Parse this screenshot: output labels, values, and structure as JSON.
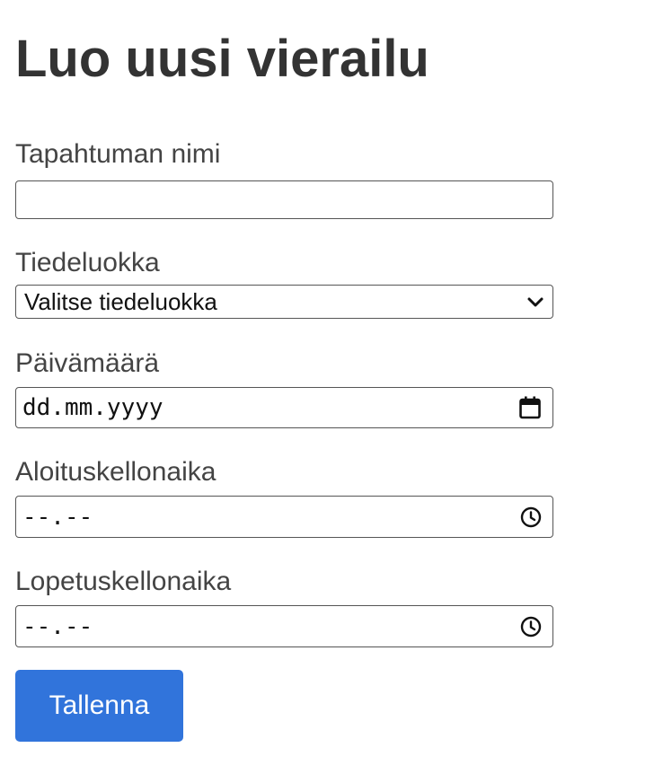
{
  "title": "Luo uusi vierailu",
  "fields": {
    "event_name": {
      "label": "Tapahtuman nimi",
      "value": ""
    },
    "category": {
      "label": "Tiedeluokka",
      "selected": "Valitse tiedeluokka"
    },
    "date": {
      "label": "Päivämäärä",
      "value": "dd.mm.yyyy"
    },
    "start_time": {
      "label": "Aloituskellonaika",
      "value": "--.--"
    },
    "end_time": {
      "label": "Lopetuskellonaika",
      "value": "--.--"
    }
  },
  "submit_label": "Tallenna",
  "colors": {
    "accent": "#3174db",
    "text": "#444444"
  },
  "icons": {
    "category": "chevron-down-icon",
    "date": "calendar-icon",
    "time": "clock-icon"
  }
}
